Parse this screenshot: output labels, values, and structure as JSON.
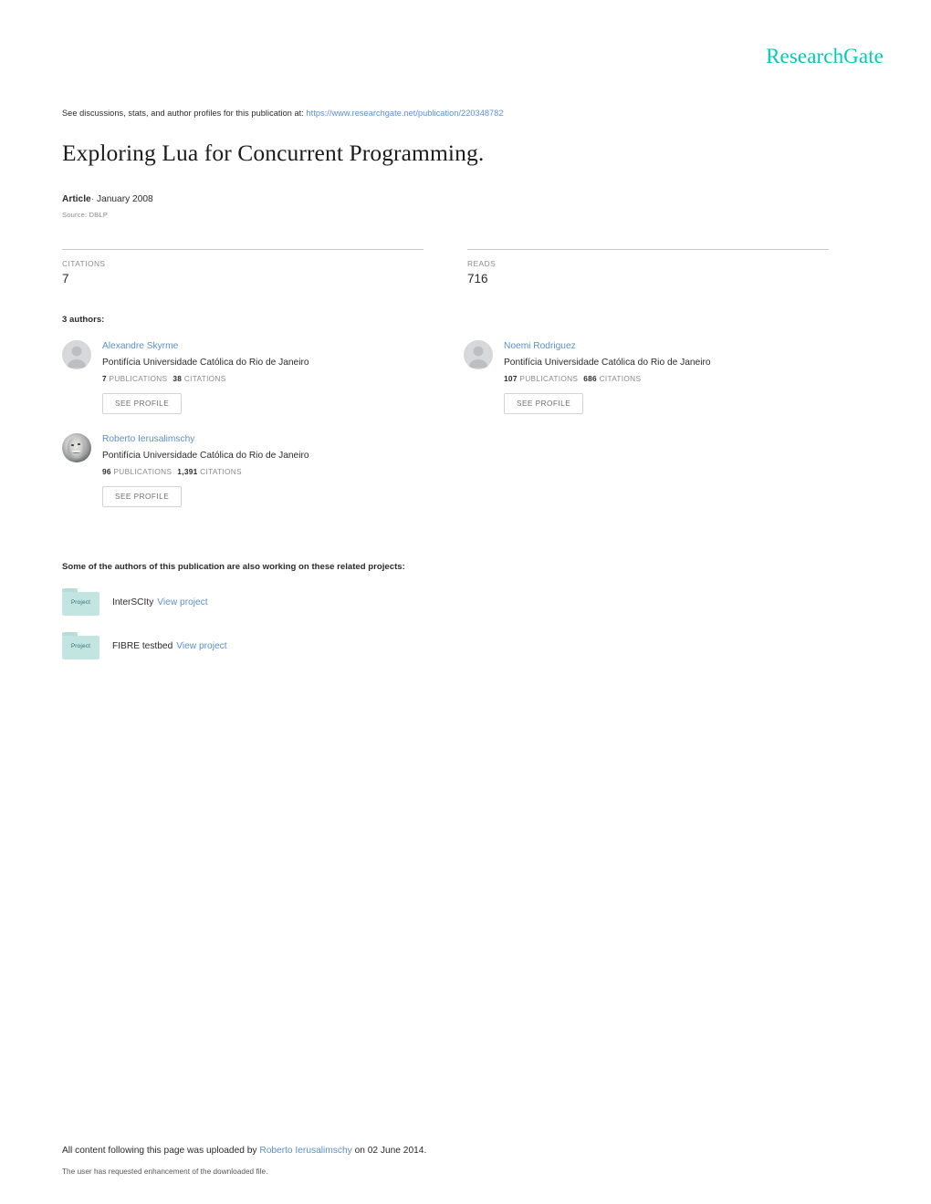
{
  "brand": {
    "name": "ResearchGate",
    "color": "#00ccb3"
  },
  "header": {
    "discuss_prefix": "See discussions, stats, and author profiles for this publication at:",
    "publication_url": "https://www.researchgate.net/publication/220348782"
  },
  "publication": {
    "title": "Exploring Lua for Concurrent Programming.",
    "type": "Article",
    "separator": "·",
    "date": "January 2008",
    "source": "Source: DBLP"
  },
  "stats": [
    {
      "label": "CITATIONS",
      "value": "7"
    },
    {
      "label": "READS",
      "value": "716"
    }
  ],
  "authors_section": {
    "heading": "3 authors:",
    "see_profile_label": "SEE PROFILE",
    "publications_label": "PUBLICATIONS",
    "citations_label": "CITATIONS",
    "authors": [
      {
        "name": "Alexandre Skyrme",
        "affiliation": "Pontifícia Universidade Católica do Rio de Janeiro",
        "publications": "7",
        "citations": "38",
        "avatar_type": "placeholder"
      },
      {
        "name": "Noemi Rodriguez",
        "affiliation": "Pontifícia Universidade Católica do Rio de Janeiro",
        "publications": "107",
        "citations": "686",
        "avatar_type": "placeholder"
      },
      {
        "name": "Roberto Ierusalimschy",
        "affiliation": "Pontifícia Universidade Católica do Rio de Janeiro",
        "publications": "96",
        "citations": "1,391",
        "avatar_type": "photo"
      }
    ]
  },
  "projects_section": {
    "heading": "Some of the authors of this publication are also working on these related projects:",
    "icon_label": "Project",
    "view_label": "View project",
    "projects": [
      {
        "name": "InterSCIty"
      },
      {
        "name": "FIBRE testbed"
      }
    ]
  },
  "footer": {
    "upload_prefix": "All content following this page was uploaded by",
    "uploader": "Roberto Ierusalimschy",
    "upload_suffix": "on 02 June 2014.",
    "note": "The user has requested enhancement of the downloaded file."
  }
}
